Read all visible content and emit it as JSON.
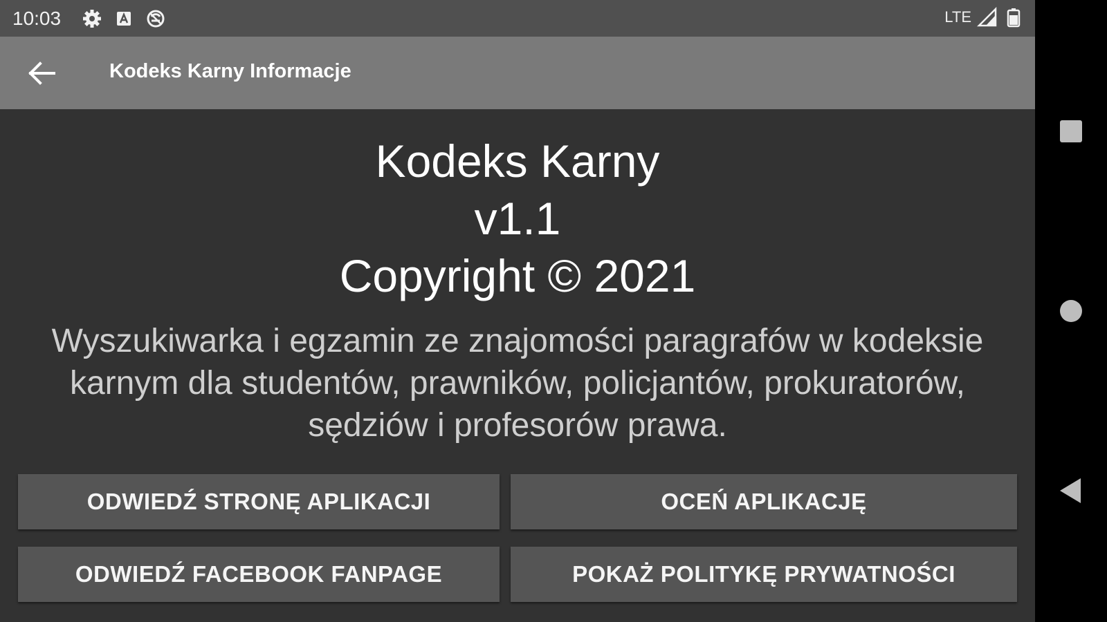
{
  "status_bar": {
    "time": "10:03",
    "left_icons": [
      "gear-icon",
      "a-icon",
      "sync-icon"
    ],
    "network": "LTE",
    "right_icons": [
      "signal-icon",
      "battery-icon"
    ]
  },
  "app_bar": {
    "back_icon": "arrow-left-icon",
    "title": "Kodeks Karny Informacje"
  },
  "content": {
    "app_name": "Kodeks Karny",
    "version": "v1.1",
    "copyright": "Copyright © 2021",
    "description": "Wyszukiwarka i egzamin ze znajomości paragrafów w kodeksie karnym dla studentów, prawników, policjantów, prokuratorów, sędziów i profesorów prawa."
  },
  "buttons": {
    "visit_app_page": "ODWIEDŹ STRONĘ APLIKACJI",
    "rate_app": "OCEŃ APLIKACJĘ",
    "visit_facebook": "ODWIEDŹ FACEBOOK FANPAGE",
    "privacy_policy": "POKAŻ POLITYKĘ PRYWATNOŚCI"
  },
  "nav_bar": {
    "icons": [
      "recents-icon",
      "home-icon",
      "back-icon"
    ]
  },
  "colors": {
    "background": "#323232",
    "app_bar": "#7a7a7a",
    "status_bar": "#505050",
    "button": "#555555",
    "nav_bar": "#000000"
  }
}
